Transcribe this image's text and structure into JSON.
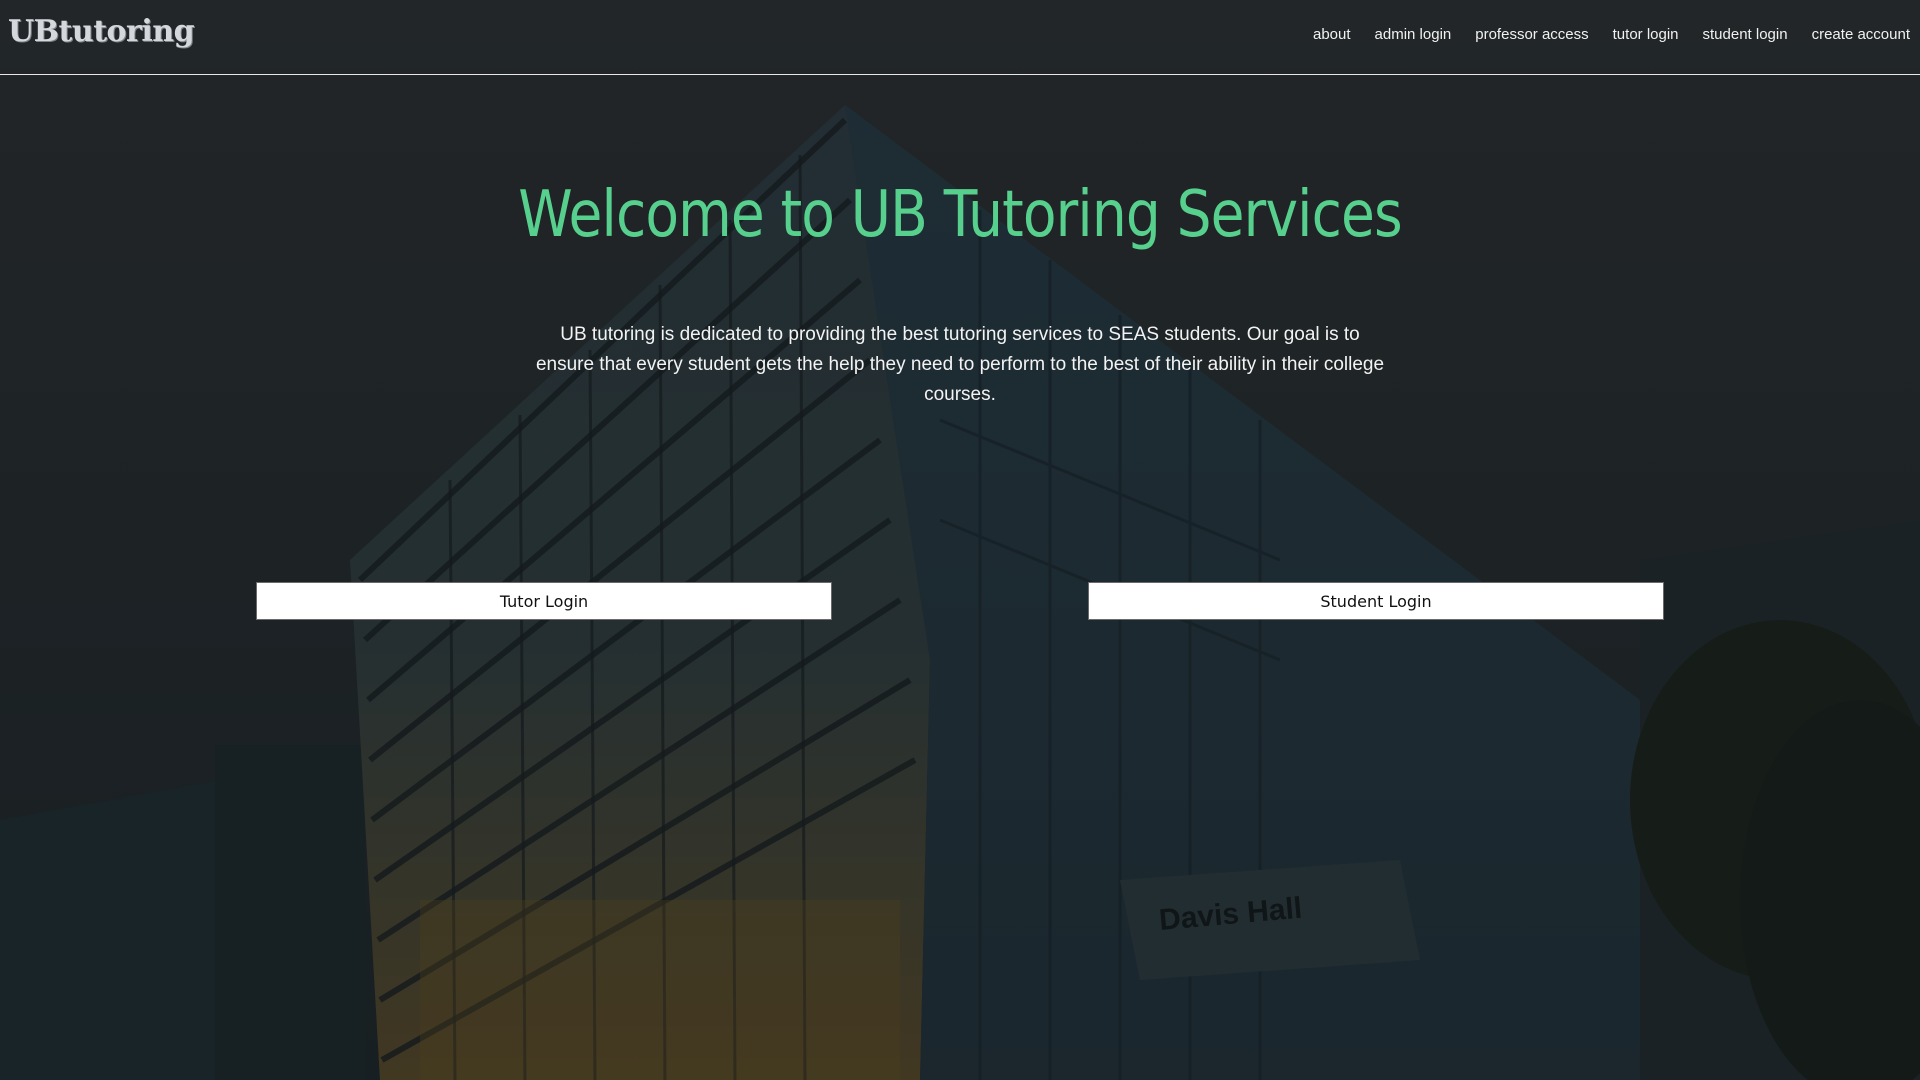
{
  "header": {
    "logo_text": "UBtutoring",
    "nav": [
      {
        "label": "about"
      },
      {
        "label": "admin login"
      },
      {
        "label": "professor access"
      },
      {
        "label": "tutor login"
      },
      {
        "label": "student login"
      },
      {
        "label": "create account"
      }
    ]
  },
  "hero": {
    "title": "Welcome to UB Tutoring Services",
    "description": "UB tutoring is dedicated to providing the best tutoring services to SEAS students. Our goal is to ensure that every student gets the help they need to perform to the best of their ability in their college courses.",
    "buttons": {
      "tutor_login": "Tutor Login",
      "student_login": "Student Login"
    },
    "background_sign_text": "Davis Hall"
  },
  "colors": {
    "accent": "#57d08d",
    "background": "#22282a",
    "nav_text": "#f1f1f1"
  }
}
